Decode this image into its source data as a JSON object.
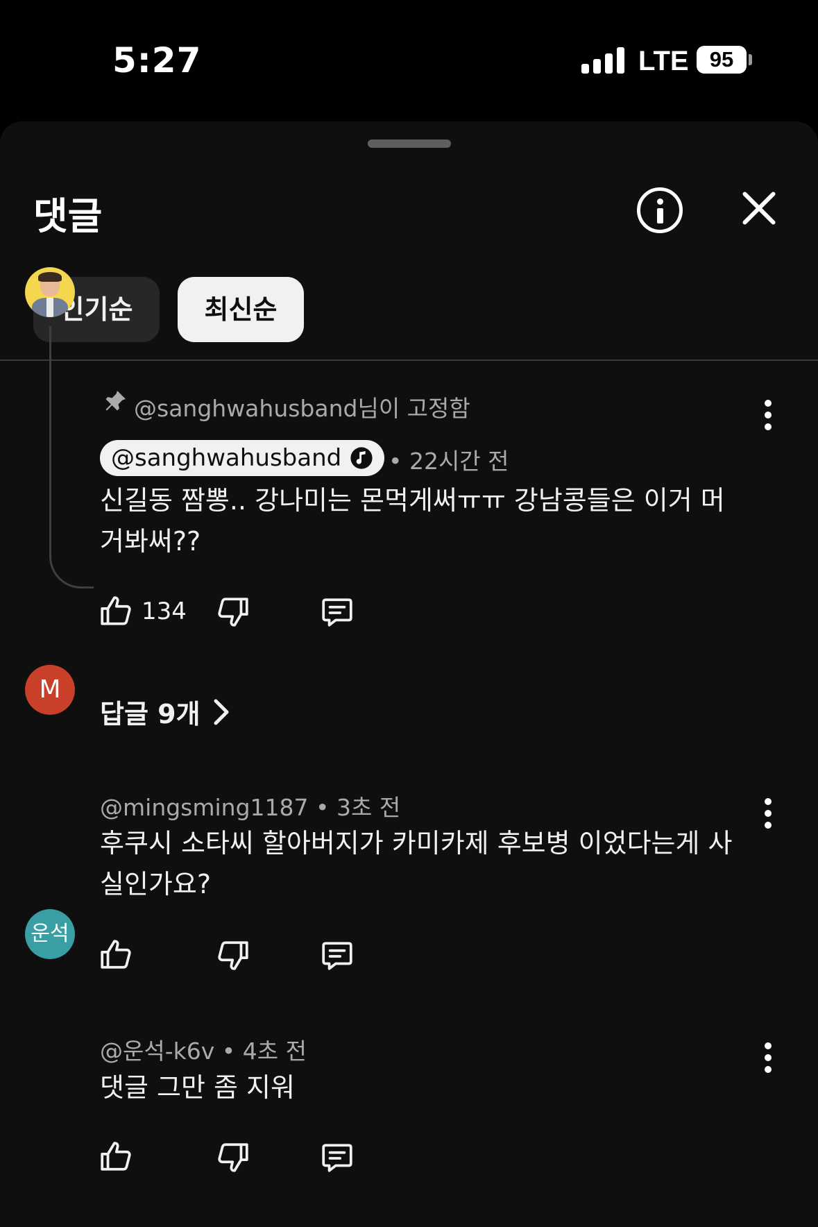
{
  "status_bar": {
    "time": "5:27",
    "network": "LTE",
    "battery": "95"
  },
  "sheet": {
    "title": "댓글"
  },
  "sort_chips": [
    {
      "label": "인기순",
      "selected": false
    },
    {
      "label": "최신순",
      "selected": true
    }
  ],
  "comments": [
    {
      "pinned_text": "@sanghwahusband님이 고정함",
      "author": "@sanghwahusband",
      "author_is_owner": true,
      "time": "• 22시간 전",
      "text_line1": "신길동 짬뽕.. 강나미는 몬먹게써ㅠㅠ 강남콩들은 이거 머",
      "text_line2": "거봐써??",
      "likes": "134",
      "replies_label": "답글 9개"
    },
    {
      "avatar_letter": "M",
      "author": "@mingsming1187",
      "time": "• 3초 전",
      "text_line1": "후쿠시 소타씨 할아버지가 카미카제 후보병 이었다는게 사",
      "text_line2": "실인가요?"
    },
    {
      "avatar_letter": "운석",
      "author": "@운석-k6v",
      "time": "• 4초 전",
      "text_line1": "댓글 그만 좀 지워"
    }
  ],
  "colors": {
    "sheet_bg": "#0f0f0f",
    "chip_selected_bg": "#f1f1f1",
    "chip_bg": "#272727",
    "avatar_m": "#c8402a",
    "avatar_ws": "#3a9ea5",
    "meta_text": "#aaaaaa"
  },
  "icons": [
    "info-icon",
    "close-icon",
    "pin-icon",
    "music-note-icon",
    "more-vert-icon",
    "thumbs-up-icon",
    "thumbs-down-icon",
    "reply-icon",
    "chevron-right-icon"
  ]
}
